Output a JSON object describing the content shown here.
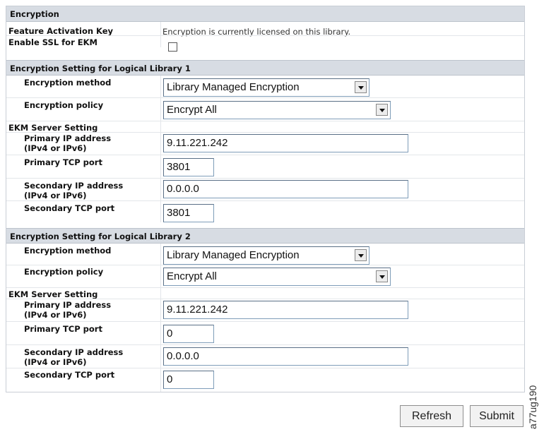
{
  "encryption": {
    "header": "Encryption",
    "feature_activation_label": "Feature Activation Key",
    "feature_activation_value": "Encryption is currently licensed on this library.",
    "enable_ssl_label": "Enable SSL for EKM",
    "enable_ssl_checked": false
  },
  "logical_library_1": {
    "header": "Encryption Setting for Logical Library 1",
    "method_label": "Encryption method",
    "method_value": "Library Managed Encryption",
    "policy_label": "Encryption policy",
    "policy_value": "Encrypt All",
    "ekm_header": "EKM Server Setting",
    "primary_ip_label_1": "Primary IP address",
    "primary_ip_label_2": "(IPv4 or IPv6)",
    "primary_ip_value": "9.11.221.242",
    "primary_port_label": "Primary TCP port",
    "primary_port_value": "3801",
    "secondary_ip_label_1": "Secondary IP address",
    "secondary_ip_label_2": "(IPv4 or IPv6)",
    "secondary_ip_value": "0.0.0.0",
    "secondary_port_label": "Secondary TCP port",
    "secondary_port_value": "3801"
  },
  "logical_library_2": {
    "header": "Encryption Setting for Logical Library 2",
    "method_label": "Encryption method",
    "method_value": "Library Managed Encryption",
    "policy_label": "Encryption policy",
    "policy_value": "Encrypt All",
    "ekm_header": "EKM Server Setting",
    "primary_ip_label_1": "Primary IP address",
    "primary_ip_label_2": "(IPv4 or IPv6)",
    "primary_ip_value": "9.11.221.242",
    "primary_port_label": "Primary TCP port",
    "primary_port_value": "0",
    "secondary_ip_label_1": "Secondary IP address",
    "secondary_ip_label_2": "(IPv4 or IPv6)",
    "secondary_ip_value": "0.0.0.0",
    "secondary_port_label": "Secondary TCP port",
    "secondary_port_value": "0"
  },
  "buttons": {
    "refresh": "Refresh",
    "submit": "Submit"
  },
  "figure_code": "a77ug190",
  "colors": {
    "header_bg": "#d7dce3",
    "border": "#c9ced6"
  }
}
